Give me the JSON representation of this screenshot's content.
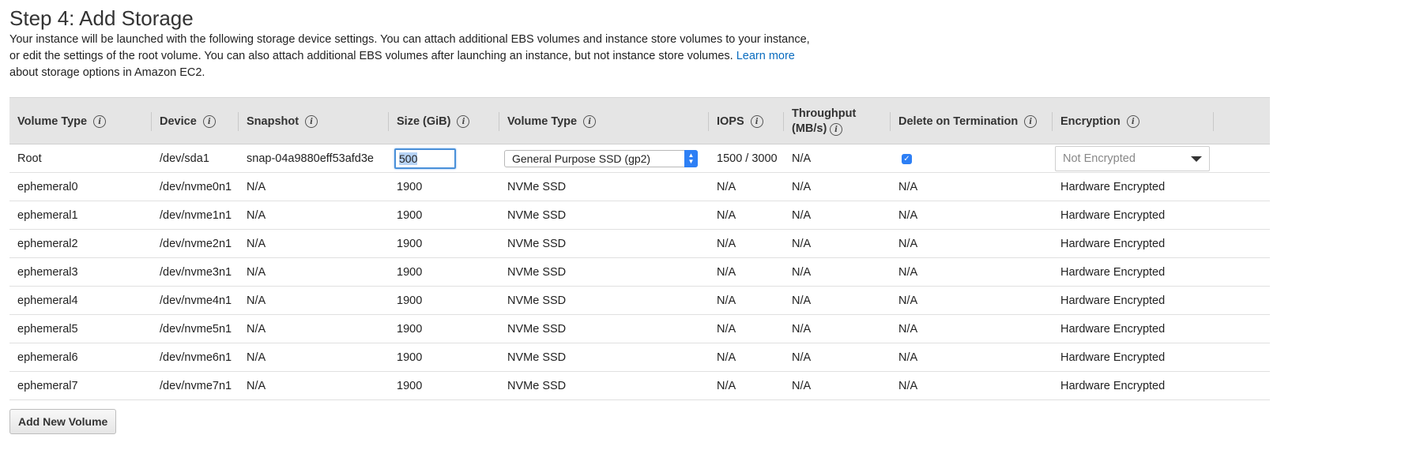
{
  "page": {
    "title": "Step 4: Add Storage",
    "desc_part1": "Your instance will be launched with the following storage device settings. You can attach additional EBS volumes and instance store volumes to your instance, or edit the settings of the root volume. You can also attach additional EBS volumes after launching an instance, but not instance store volumes.",
    "learn_more": "Learn more",
    "desc_part2": "about storage options in Amazon EC2."
  },
  "table": {
    "headers": {
      "volume_type": "Volume Type",
      "device": "Device",
      "snapshot": "Snapshot",
      "size": "Size (GiB)",
      "volume_type2": "Volume Type",
      "iops": "IOPS",
      "throughput": "Throughput (MB/s)",
      "delete_on_termination": "Delete on Termination",
      "encryption": "Encryption"
    },
    "info_glyph": "i",
    "root": {
      "volume_type": "Root",
      "device": "/dev/sda1",
      "snapshot": "snap-04a9880eff53afd3e",
      "size": "500",
      "volume_type_select": "General Purpose SSD (gp2)",
      "iops": "1500 / 3000",
      "throughput": "N/A",
      "delete_on_termination": true,
      "encryption": "Not Encrypted"
    },
    "rows": [
      {
        "volume_type": "ephemeral0",
        "device": "/dev/nvme0n1",
        "snapshot": "N/A",
        "size": "1900",
        "vtype": "NVMe SSD",
        "iops": "N/A",
        "throughput": "N/A",
        "delete": "N/A",
        "encryption": "Hardware Encrypted"
      },
      {
        "volume_type": "ephemeral1",
        "device": "/dev/nvme1n1",
        "snapshot": "N/A",
        "size": "1900",
        "vtype": "NVMe SSD",
        "iops": "N/A",
        "throughput": "N/A",
        "delete": "N/A",
        "encryption": "Hardware Encrypted"
      },
      {
        "volume_type": "ephemeral2",
        "device": "/dev/nvme2n1",
        "snapshot": "N/A",
        "size": "1900",
        "vtype": "NVMe SSD",
        "iops": "N/A",
        "throughput": "N/A",
        "delete": "N/A",
        "encryption": "Hardware Encrypted"
      },
      {
        "volume_type": "ephemeral3",
        "device": "/dev/nvme3n1",
        "snapshot": "N/A",
        "size": "1900",
        "vtype": "NVMe SSD",
        "iops": "N/A",
        "throughput": "N/A",
        "delete": "N/A",
        "encryption": "Hardware Encrypted"
      },
      {
        "volume_type": "ephemeral4",
        "device": "/dev/nvme4n1",
        "snapshot": "N/A",
        "size": "1900",
        "vtype": "NVMe SSD",
        "iops": "N/A",
        "throughput": "N/A",
        "delete": "N/A",
        "encryption": "Hardware Encrypted"
      },
      {
        "volume_type": "ephemeral5",
        "device": "/dev/nvme5n1",
        "snapshot": "N/A",
        "size": "1900",
        "vtype": "NVMe SSD",
        "iops": "N/A",
        "throughput": "N/A",
        "delete": "N/A",
        "encryption": "Hardware Encrypted"
      },
      {
        "volume_type": "ephemeral6",
        "device": "/dev/nvme6n1",
        "snapshot": "N/A",
        "size": "1900",
        "vtype": "NVMe SSD",
        "iops": "N/A",
        "throughput": "N/A",
        "delete": "N/A",
        "encryption": "Hardware Encrypted"
      },
      {
        "volume_type": "ephemeral7",
        "device": "/dev/nvme7n1",
        "snapshot": "N/A",
        "size": "1900",
        "vtype": "NVMe SSD",
        "iops": "N/A",
        "throughput": "N/A",
        "delete": "N/A",
        "encryption": "Hardware Encrypted"
      }
    ]
  },
  "actions": {
    "add_volume": "Add New Volume"
  },
  "icons": {
    "info": "info-icon",
    "checkbox": "checkbox-checked-icon",
    "dropdown": "caret-down-icon",
    "stepper": "select-stepper-icon"
  },
  "colors": {
    "link": "#0a6cbf",
    "header_bg": "#e5e5e5",
    "accent": "#2d7ff5"
  }
}
